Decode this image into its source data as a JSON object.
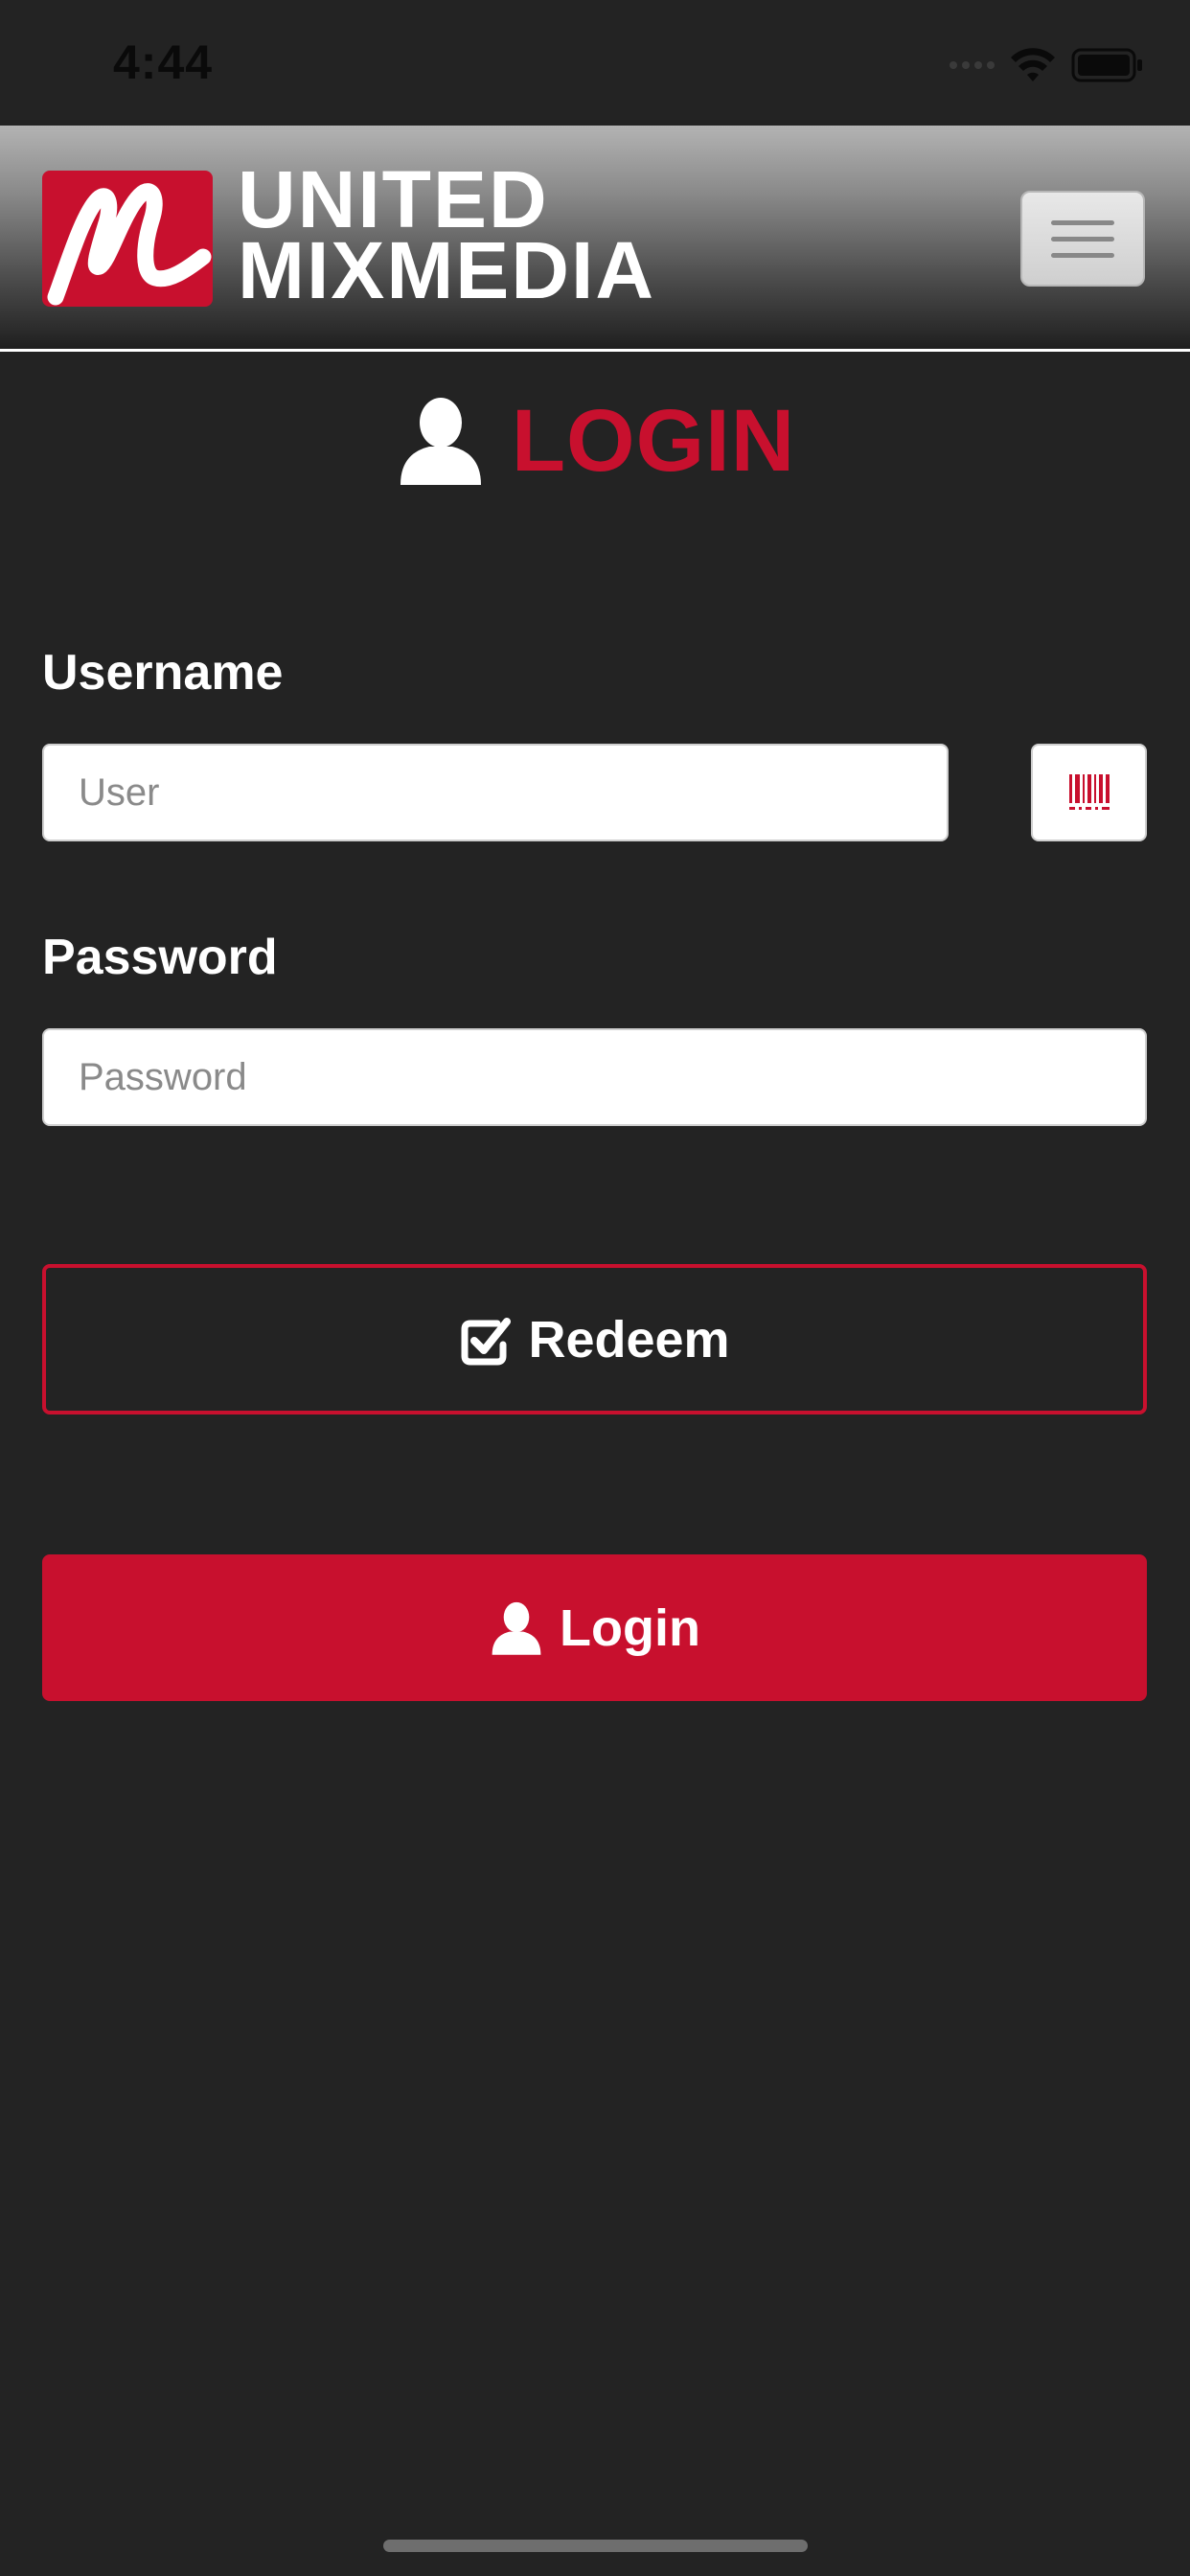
{
  "status_bar": {
    "time": "4:44"
  },
  "header": {
    "brand_line1": "UNITED",
    "brand_line2": "MIXMEDIA",
    "logo_icon": "mixmedia-logo-icon",
    "menu_icon": "hamburger-menu-icon"
  },
  "page": {
    "title": "LOGIN",
    "title_icon": "user-icon"
  },
  "form": {
    "username_label": "Username",
    "username_placeholder": "User",
    "username_value": "",
    "barcode_icon": "barcode-icon",
    "password_label": "Password",
    "password_placeholder": "Password",
    "password_value": ""
  },
  "actions": {
    "redeem_label": "Redeem",
    "redeem_icon": "checkbox-icon",
    "login_label": "Login",
    "login_icon": "user-icon"
  },
  "colors": {
    "accent": "#c8102e",
    "background": "#232323",
    "text": "#ffffff"
  }
}
